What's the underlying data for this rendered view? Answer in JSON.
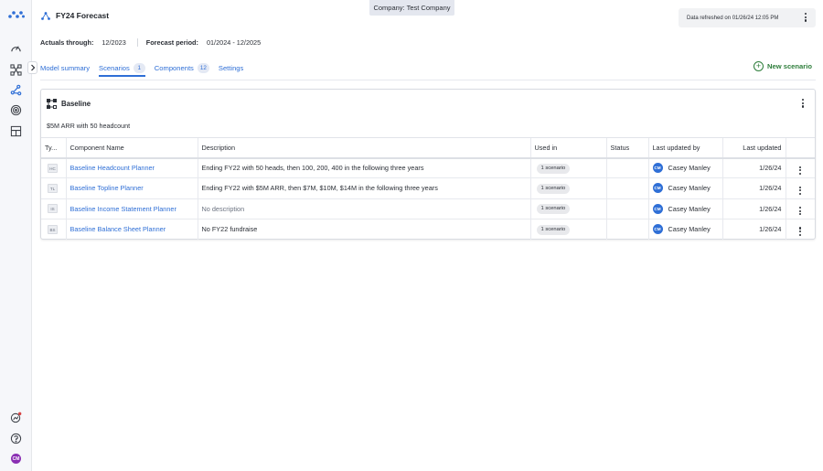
{
  "header": {
    "title": "FY24 Forecast",
    "company": "Company: Test Company",
    "refresh_text": "Data refreshed on 01/26/24 12:05 PM"
  },
  "meta": {
    "actuals_label": "Actuals through:",
    "actuals_value": "12/2023",
    "forecast_label": "Forecast period:",
    "forecast_value": "01/2024 - 12/2025"
  },
  "tabs": [
    {
      "label": "Model summary",
      "count": null
    },
    {
      "label": "Scenarios",
      "count": "1",
      "active": true
    },
    {
      "label": "Components",
      "count": "12"
    },
    {
      "label": "Settings",
      "count": null
    }
  ],
  "new_scenario_label": "New scenario",
  "card": {
    "title": "Baseline",
    "subtitle": "$5M ARR with 50 headcount",
    "columns": [
      "Ty...",
      "Component Name",
      "Description",
      "Used in",
      "Status",
      "Last updated by",
      "Last updated"
    ],
    "rows": [
      {
        "type": "HC",
        "name": "Baseline Headcount Planner",
        "description": "Ending FY22 with 50 heads, then 100, 200, 400 in the following three years",
        "used_in": "1 scenario",
        "status": "",
        "user_initials": "CM",
        "user": "Casey Manley",
        "updated": "1/26/24"
      },
      {
        "type": "TL",
        "name": "Baseline Topline Planner",
        "description": "Ending FY22 with $5M ARR, then $7M, $10M, $14M in the following three years",
        "used_in": "1 scenario",
        "status": "",
        "user_initials": "CM",
        "user": "Casey Manley",
        "updated": "1/26/24"
      },
      {
        "type": "IS",
        "name": "Baseline Income Statement Planner",
        "description": "No description",
        "used_in": "1 scenario",
        "status": "",
        "user_initials": "CM",
        "user": "Casey Manley",
        "updated": "1/26/24"
      },
      {
        "type": "BS",
        "name": "Baseline Balance Sheet Planner",
        "description": "No FY22 fundraise",
        "used_in": "1 scenario",
        "status": "",
        "user_initials": "CM",
        "user": "Casey Manley",
        "updated": "1/26/24"
      }
    ]
  },
  "rail": {
    "icons": [
      "dashboard-gauge-icon",
      "model-graph-icon",
      "scenarios-branch-icon",
      "target-icon",
      "components-grid-icon"
    ],
    "bottom_icons": [
      "integrations-icon",
      "help-icon"
    ],
    "user_initials": "CM"
  },
  "colors": {
    "accent": "#2f6fd6",
    "new_scenario": "#2d7d3a",
    "rail_bg": "#f6f7fa"
  }
}
